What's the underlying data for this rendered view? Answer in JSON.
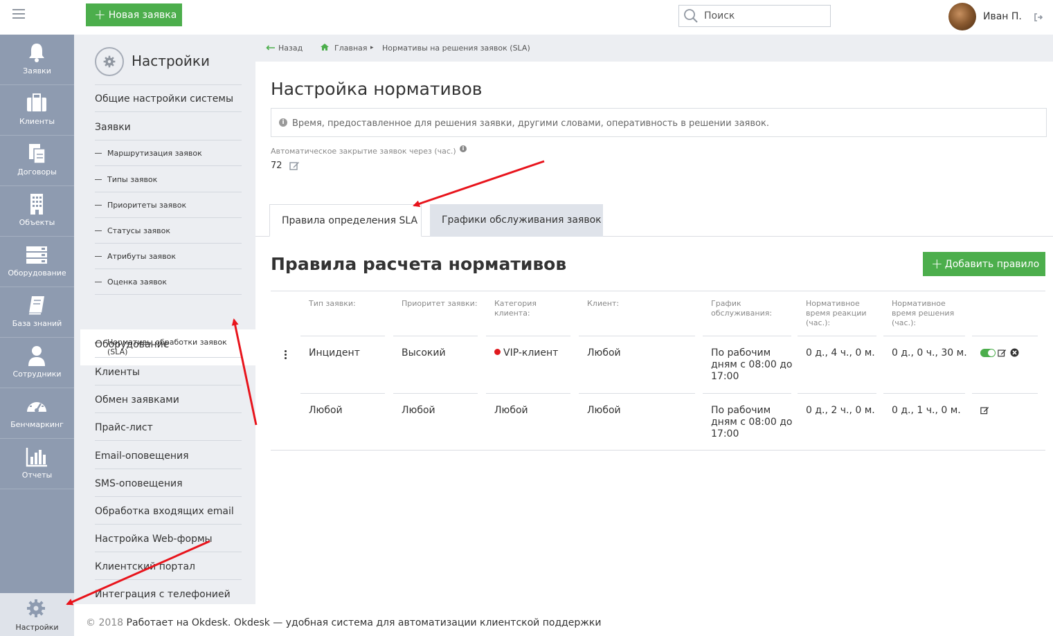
{
  "topbar": {
    "new_request_label": "Новая заявка",
    "search_placeholder": "Поиск",
    "user_name": "Иван П."
  },
  "leftnav": {
    "items": [
      {
        "label": "Заявки",
        "icon": "bell-icon"
      },
      {
        "label": "Клиенты",
        "icon": "briefcase-icon"
      },
      {
        "label": "Договоры",
        "icon": "documents-icon"
      },
      {
        "label": "Объекты",
        "icon": "building-icon"
      },
      {
        "label": "Оборудование",
        "icon": "server-icon"
      },
      {
        "label": "База знаний",
        "icon": "book-icon"
      },
      {
        "label": "Сотрудники",
        "icon": "user-icon"
      },
      {
        "label": "Бенчмаркинг",
        "icon": "gauge-icon"
      },
      {
        "label": "Отчеты",
        "icon": "bar-chart-icon"
      }
    ],
    "settings_label": "Настройки"
  },
  "submenu": {
    "title": "Настройки",
    "items": [
      "Общие настройки системы",
      "Заявки",
      "Маршрутизация заявок",
      "Типы заявок",
      "Приоритеты заявок",
      "Статусы заявок",
      "Атрибуты заявок",
      "Оценка заявок",
      "Нормативы обработки заявок (SLA)",
      "Оборудование",
      "Клиенты",
      "Обмен заявками",
      "Прайс-лист",
      "Email-оповещения",
      "SMS-оповещения",
      "Обработка входящих email",
      "Настройка Web-формы",
      "Клиентский портал",
      "Интеграция с телефонией"
    ]
  },
  "breadcrumb": {
    "back": "Назад",
    "home": "Главная",
    "current": "Нормативы на решения заявок (SLA)"
  },
  "main": {
    "page_title": "Настройка нормативов",
    "info_text": "Время, предоставленное для решения заявки, другими словами, оперативность в решении заявок.",
    "auto_close_label": "Автоматическое закрытие заявок через (час.)",
    "auto_close_value": "72",
    "tabs": [
      "Правила определения SLA",
      "Графики обслуживания заявок"
    ],
    "section_title": "Правила расчета нормативов",
    "add_rule_label": "Добавить правило"
  },
  "table": {
    "headers": [
      "Тип заявки:",
      "Приоритет заявки:",
      "Категория клиента:",
      "Клиент:",
      "График обслуживания:",
      "Нормативное время реакции (час.):",
      "Нормативное время решения (час.):"
    ],
    "rows": [
      {
        "type": "Инцидент",
        "priority": "Высокий",
        "category": "VIP-клиент",
        "client": "Любой",
        "schedule": "По рабочим дням с 08:00 до 17:00",
        "reaction": "0 д., 4 ч., 0 м.",
        "resolution": "0 д., 0 ч., 30 м."
      },
      {
        "type": "Любой",
        "priority": "Любой",
        "category": "Любой",
        "client": "Любой",
        "schedule": "По рабочим дням с 08:00 до 17:00",
        "reaction": "0 д., 2 ч., 0 м.",
        "resolution": "0 д., 1 ч., 0 м."
      }
    ]
  },
  "footer": {
    "copyright": "© 2018",
    "text": "Работает на Okdesk. Okdesk — удобная система для автоматизации клиентской поддержки"
  },
  "colors": {
    "accent_green": "#4cae4c",
    "nav_bg": "#8e9bb0",
    "submenu_bg": "#eceef2",
    "vip_red": "#e0191e",
    "annotation_red": "#e8141c"
  }
}
